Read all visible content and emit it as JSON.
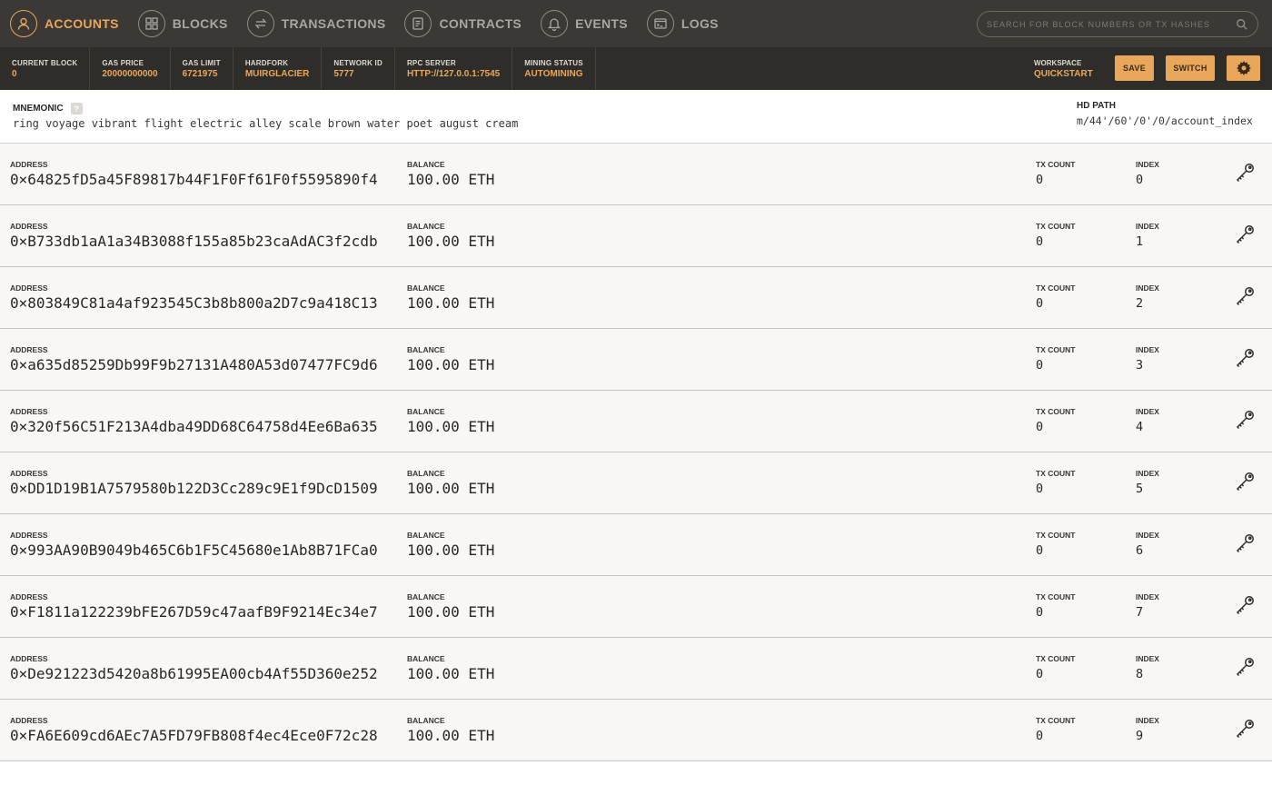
{
  "nav": {
    "items": [
      {
        "label": "ACCOUNTS",
        "icon": "person-icon"
      },
      {
        "label": "BLOCKS",
        "icon": "blocks-icon"
      },
      {
        "label": "TRANSACTIONS",
        "icon": "transactions-icon"
      },
      {
        "label": "CONTRACTS",
        "icon": "contracts-icon"
      },
      {
        "label": "EVENTS",
        "icon": "bell-icon"
      },
      {
        "label": "LOGS",
        "icon": "logs-icon"
      }
    ],
    "active": "ACCOUNTS",
    "search_placeholder": "SEARCH FOR BLOCK NUMBERS OR TX HASHES"
  },
  "status": {
    "current_block": {
      "label": "CURRENT BLOCK",
      "value": "0"
    },
    "gas_price": {
      "label": "GAS PRICE",
      "value": "20000000000"
    },
    "gas_limit": {
      "label": "GAS LIMIT",
      "value": "6721975"
    },
    "hardfork": {
      "label": "HARDFORK",
      "value": "MUIRGLACIER"
    },
    "network_id": {
      "label": "NETWORK ID",
      "value": "5777"
    },
    "rpc_server": {
      "label": "RPC SERVER",
      "value": "HTTP://127.0.0.1:7545"
    },
    "mining_status": {
      "label": "MINING STATUS",
      "value": "AUTOMINING"
    },
    "workspace": {
      "label": "WORKSPACE",
      "value": "QUICKSTART"
    },
    "save_label": "SAVE",
    "switch_label": "SWITCH"
  },
  "mnemonic": {
    "label": "MNEMONIC",
    "help": "?",
    "words": "ring voyage vibrant flight electric alley scale brown water poet august cream",
    "hd_path_label": "HD PATH",
    "hd_path": "m/44'/60'/0'/0/account_index"
  },
  "labels": {
    "address": "ADDRESS",
    "balance": "BALANCE",
    "tx_count": "TX COUNT",
    "index": "INDEX"
  },
  "accounts": [
    {
      "address": "0×64825fD5a45F89817b44F1F0Ff61F0f5595890f4",
      "balance": "100.00 ETH",
      "tx_count": "0",
      "index": "0"
    },
    {
      "address": "0×B733db1aA1a34B3088f155a85b23caAdAC3f2cdb",
      "balance": "100.00 ETH",
      "tx_count": "0",
      "index": "1"
    },
    {
      "address": "0×803849C81a4af923545C3b8b800a2D7c9a418C13",
      "balance": "100.00 ETH",
      "tx_count": "0",
      "index": "2"
    },
    {
      "address": "0×a635d85259Db99F9b27131A480A53d07477FC9d6",
      "balance": "100.00 ETH",
      "tx_count": "0",
      "index": "3"
    },
    {
      "address": "0×320f56C51F213A4dba49DD68C64758d4Ee6Ba635",
      "balance": "100.00 ETH",
      "tx_count": "0",
      "index": "4"
    },
    {
      "address": "0×DD1D19B1A7579580b122D3Cc289c9E1f9DcD1509",
      "balance": "100.00 ETH",
      "tx_count": "0",
      "index": "5"
    },
    {
      "address": "0×993AA90B9049b465C6b1F5C45680e1Ab8B71FCa0",
      "balance": "100.00 ETH",
      "tx_count": "0",
      "index": "6"
    },
    {
      "address": "0×F1811a122239bFE267D59c47aafB9F9214Ec34e7",
      "balance": "100.00 ETH",
      "tx_count": "0",
      "index": "7"
    },
    {
      "address": "0×De921223d5420a8b61995EA00cb4Af55D360e252",
      "balance": "100.00 ETH",
      "tx_count": "0",
      "index": "8"
    },
    {
      "address": "0×FA6E609cd6AEc7A5FD79FB808f4ec4Ece0F72c28",
      "balance": "100.00 ETH",
      "tx_count": "0",
      "index": "9"
    }
  ],
  "colors": {
    "accent": "#e9a75b",
    "nav_bg": "#3b3835",
    "status_bg": "#2f2d2a",
    "row_bg": "#f8f7f5"
  }
}
